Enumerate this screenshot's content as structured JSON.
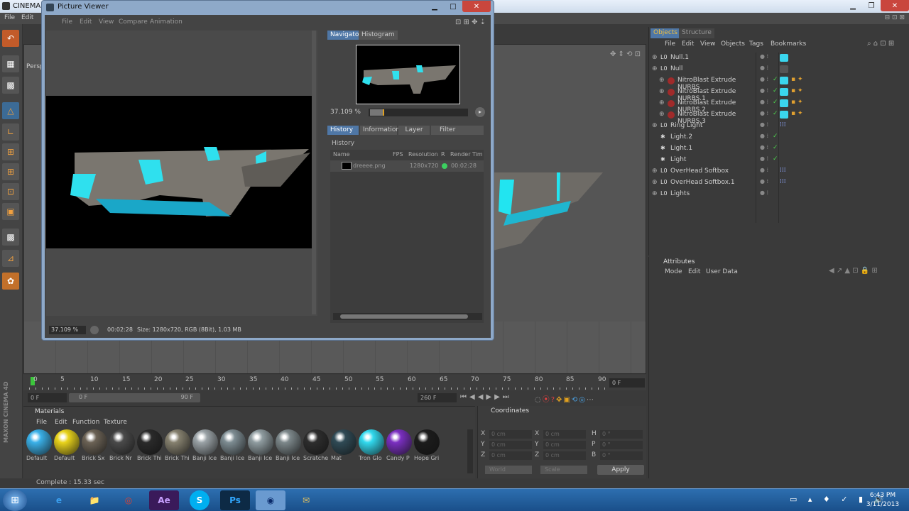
{
  "c4d": {
    "title": "CINEMA 4",
    "menu": [
      "File",
      "Edit"
    ],
    "viewport_label": "Persp"
  },
  "picture_viewer": {
    "title": "Picture Viewer",
    "menu": [
      "File",
      "Edit",
      "View",
      "Compare",
      "Animation"
    ],
    "nav_tabs": [
      "Navigator",
      "Histogram"
    ],
    "zoom": "37.109 %",
    "tabs": [
      "History",
      "Information",
      "Layer",
      "Filter"
    ],
    "history_label": "History",
    "columns": [
      "Name",
      "FPS",
      "Resolution",
      "R",
      "Render Time"
    ],
    "rows": [
      {
        "name": "dreeee.png",
        "resolution": "1280x720",
        "time": "00:02:28"
      }
    ],
    "status_zoom": "37.109 %",
    "status_time": "00:02:28",
    "status_info": "Size: 1280x720, RGB (8Bit), 1.03 MB"
  },
  "timeline": {
    "ticks": [
      "0",
      "5",
      "10",
      "15",
      "20",
      "25",
      "30",
      "35",
      "40",
      "45",
      "50",
      "55",
      "60",
      "65",
      "70",
      "75",
      "80",
      "85",
      "90"
    ],
    "frame_field": "0 F",
    "start": "0 F",
    "range_start": "0 F",
    "range_end": "90 F",
    "end": "260 F"
  },
  "materials": {
    "title": "Materials",
    "menu": [
      "File",
      "Edit",
      "Function",
      "Texture"
    ],
    "items": [
      {
        "label": "Default",
        "color": "#3ab0e8"
      },
      {
        "label": "Default",
        "color": "#e8d21a"
      },
      {
        "label": "Brick Sx",
        "color": "#6b6255"
      },
      {
        "label": "Brick Nr",
        "color": "#4a4a4a"
      },
      {
        "label": "Brick Thi",
        "color": "#2a2a2a"
      },
      {
        "label": "Brick Thi",
        "color": "#85806e"
      },
      {
        "label": "Banji Ice",
        "color": "#9aa2a6"
      },
      {
        "label": "Banji Ice",
        "color": "#7d8c92"
      },
      {
        "label": "Banji Ice",
        "color": "#8f9ca0"
      },
      {
        "label": "Banji Ice",
        "color": "#7c878a"
      },
      {
        "label": "Scratche",
        "color": "#2d2d2d"
      },
      {
        "label": "Mat",
        "color": "#2f4a55"
      },
      {
        "label": "Tron Glo",
        "color": "#31d9ee"
      },
      {
        "label": "Candy P",
        "color": "#7a2fc0"
      },
      {
        "label": "Hope Gri",
        "color": "#1c1c1c"
      }
    ]
  },
  "coords": {
    "title": "Coordinates",
    "rows": [
      {
        "a": "X",
        "av": "0 cm",
        "b": "X",
        "bv": "0 cm",
        "c": "H",
        "cv": "0 °"
      },
      {
        "a": "Y",
        "av": "0 cm",
        "b": "Y",
        "bv": "0 cm",
        "c": "P",
        "cv": "0 °"
      },
      {
        "a": "Z",
        "av": "0 cm",
        "b": "Z",
        "bv": "0 cm",
        "c": "B",
        "cv": "0 °"
      }
    ],
    "world": "World",
    "scale": "Scale",
    "apply": "Apply"
  },
  "objects": {
    "tabs": [
      "Objects",
      "Structure"
    ],
    "menu": [
      "File",
      "Edit",
      "View",
      "Objects",
      "Tags",
      "Bookmarks"
    ],
    "items": [
      {
        "name": "Null.1",
        "type": "L0"
      },
      {
        "name": "Null",
        "type": "L0"
      },
      {
        "name": "NitroBlast Extrude NURBS",
        "type": "nurbs"
      },
      {
        "name": "NitroBlast Extrude NURBS.1",
        "type": "nurbs"
      },
      {
        "name": "NitroBlast Extrude NURBS.2",
        "type": "nurbs"
      },
      {
        "name": "NitroBlast Extrude NURBS.3",
        "type": "nurbs"
      },
      {
        "name": "Ring Light",
        "type": "L0"
      },
      {
        "name": "Light.2",
        "type": "light"
      },
      {
        "name": "Light.1",
        "type": "light"
      },
      {
        "name": "Light",
        "type": "light"
      },
      {
        "name": "OverHead Softbox",
        "type": "L0"
      },
      {
        "name": "OverHead Softbox.1",
        "type": "L0"
      },
      {
        "name": "Lights",
        "type": "L0"
      }
    ]
  },
  "attributes": {
    "title": "Attributes",
    "menu": [
      "Mode",
      "Edit",
      "User Data"
    ]
  },
  "status": "Complete : 15.33 sec",
  "taskbar": {
    "apps": [
      "e",
      "📁",
      "◎",
      "Ae",
      "S",
      "Ps",
      "◉",
      "✉"
    ],
    "time": "6:43 PM",
    "date": "3/11/2013"
  }
}
